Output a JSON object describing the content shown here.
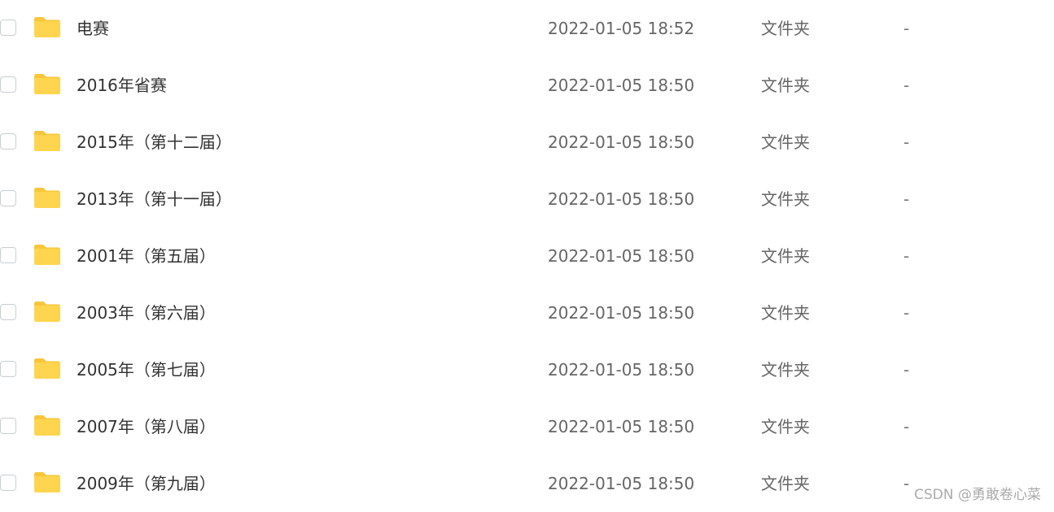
{
  "files": [
    {
      "name": "电赛",
      "modified": "2022-01-05 18:52",
      "type": "文件夹",
      "size": "-"
    },
    {
      "name": "2016年省赛",
      "modified": "2022-01-05 18:50",
      "type": "文件夹",
      "size": "-"
    },
    {
      "name": "2015年（第十二届）",
      "modified": "2022-01-05 18:50",
      "type": "文件夹",
      "size": "-"
    },
    {
      "name": "2013年（第十一届）",
      "modified": "2022-01-05 18:50",
      "type": "文件夹",
      "size": "-"
    },
    {
      "name": "2001年（第五届）",
      "modified": "2022-01-05 18:50",
      "type": "文件夹",
      "size": "-"
    },
    {
      "name": "2003年（第六届）",
      "modified": "2022-01-05 18:50",
      "type": "文件夹",
      "size": "-"
    },
    {
      "name": "2005年（第七届）",
      "modified": "2022-01-05 18:50",
      "type": "文件夹",
      "size": "-"
    },
    {
      "name": "2007年（第八届）",
      "modified": "2022-01-05 18:50",
      "type": "文件夹",
      "size": "-"
    },
    {
      "name": "2009年（第九届）",
      "modified": "2022-01-05 18:50",
      "type": "文件夹",
      "size": "-"
    }
  ],
  "watermark": "CSDN @勇敢卷心菜",
  "icons": {
    "folder": "folder-icon",
    "checkbox": "checkbox"
  },
  "colors": {
    "folder": "#FFD54F",
    "folder_tab": "#F8C63A",
    "name_text": "#333333",
    "meta_text": "#666666",
    "checkbox_border": "#C9CED6"
  }
}
